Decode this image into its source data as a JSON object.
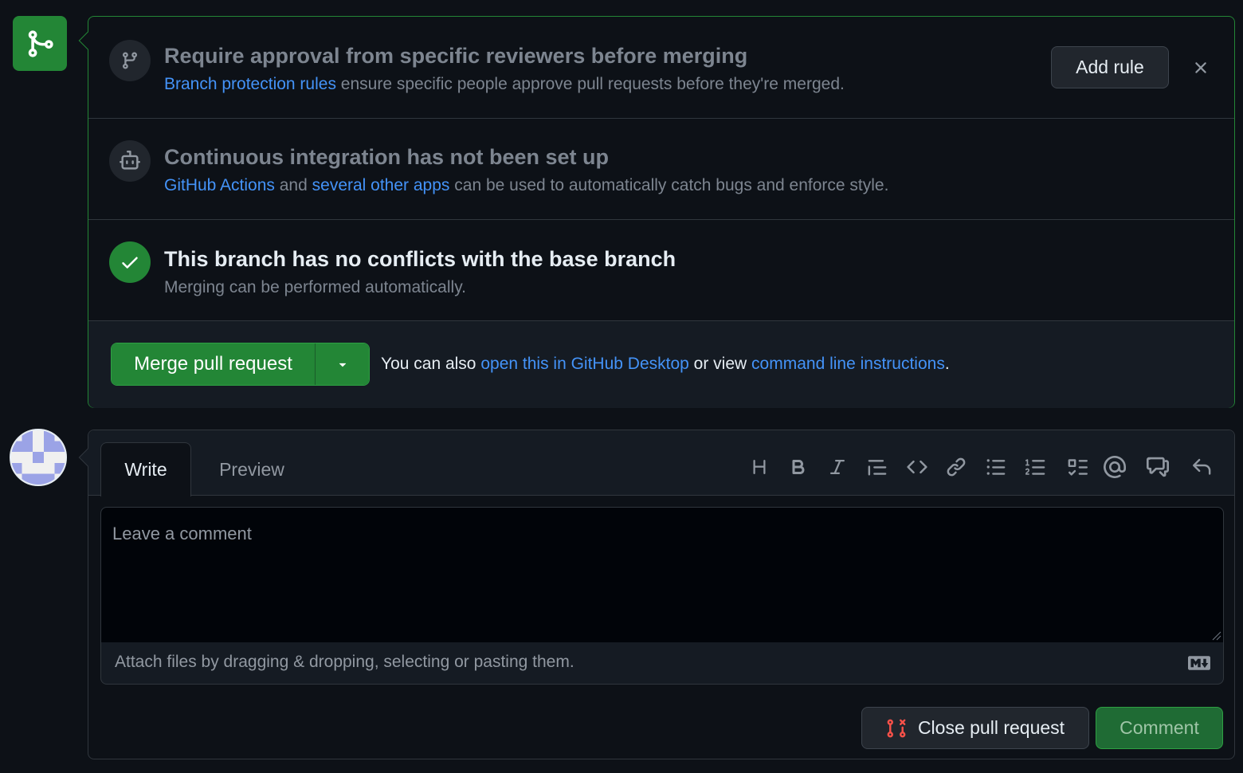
{
  "merge_box": {
    "approval": {
      "title": "Require approval from specific reviewers before merging",
      "link": "Branch protection rules",
      "text": "ensure specific people approve pull requests before they're merged.",
      "add_rule_label": "Add rule"
    },
    "ci": {
      "title": "Continuous integration has not been set up",
      "link1": "GitHub Actions",
      "and": "and",
      "link2": "several other apps",
      "text": "can be used to automatically catch bugs and enforce style."
    },
    "conflicts": {
      "title": "This branch has no conflicts with the base branch",
      "text": "Merging can be performed automatically."
    },
    "footer": {
      "merge_label": "Merge pull request",
      "hint_prefix": "You can also",
      "hint_link1": "open this in GitHub Desktop",
      "hint_mid": "or view",
      "hint_link2": "command line instructions",
      "hint_suffix": "."
    }
  },
  "comment": {
    "tabs": [
      "Write",
      "Preview"
    ],
    "placeholder": "Leave a comment",
    "attach_text": "Attach files by dragging & dropping, selecting or pasting them.",
    "close_pr_label": "Close pull request",
    "comment_label": "Comment",
    "toolbar_icons": [
      "heading-icon",
      "bold-icon",
      "italic-icon",
      "quote-icon",
      "code-icon",
      "link-icon",
      "unordered-list-icon",
      "ordered-list-icon",
      "task-list-icon",
      "mention-icon",
      "cross-reference-icon",
      "undo-icon"
    ]
  },
  "colors": {
    "success": "#238636",
    "link": "#4493f8",
    "danger": "#f85149",
    "canvas": "#0d1117"
  }
}
